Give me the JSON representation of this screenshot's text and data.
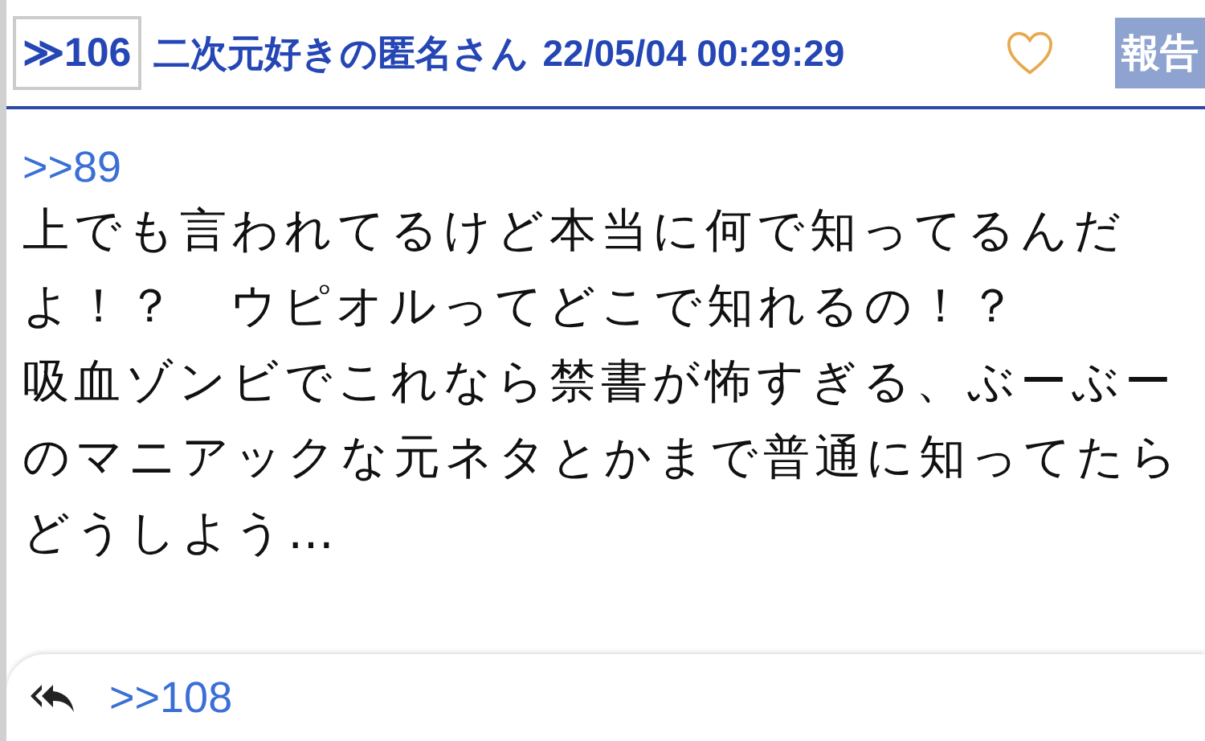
{
  "post": {
    "number": "≫106",
    "author": "二次元好きの匿名さん",
    "datetime": "22/05/04 00:29:29",
    "liked": false,
    "report_label": "報告"
  },
  "body": {
    "anchor": ">>89",
    "paragraphs": [
      "上でも言われてるけど本当に何で知ってるんだよ！？　ウピオルってどこで知れるの！？",
      "吸血ゾンビでこれなら禁書が怖すぎる、ぶーぶーのマニアックな元ネタとかまで普通に知ってたらどうしよう…"
    ]
  },
  "replies": [
    ">>108"
  ]
}
